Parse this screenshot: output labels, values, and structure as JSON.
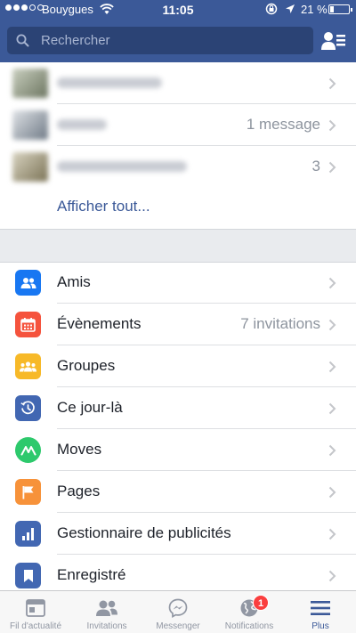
{
  "colors": {
    "brand": "#3b5998",
    "search_bg": "#2b4375",
    "separator": "#dddfe2",
    "muted_text": "#8d949e",
    "badge": "#fa3e3e"
  },
  "status_bar": {
    "carrier": "Bouygues",
    "time": "11:05",
    "battery_percent": "21 %",
    "battery_level": 0.21,
    "icons": [
      "signal-dots-icon",
      "wifi-icon",
      "rotation-lock-icon",
      "location-arrow-icon",
      "battery-icon"
    ]
  },
  "search": {
    "placeholder": "Rechercher",
    "value": "",
    "icon": "search-icon"
  },
  "header": {
    "right_icon": "friend-requests-icon"
  },
  "groups": {
    "items": [
      {
        "name_blurred": true,
        "right_text": "",
        "thumb_color": "#7d8a6e"
      },
      {
        "name_blurred": true,
        "right_text": "1 message",
        "thumb_color": "#6f7a86"
      },
      {
        "name_blurred": true,
        "right_text": "3",
        "thumb_color": "#a89a6b"
      }
    ],
    "see_all": "Afficher tout..."
  },
  "menu": {
    "items": [
      {
        "label": "Amis",
        "right_text": "",
        "icon": "friends-icon",
        "color": "#1877f2"
      },
      {
        "label": "Évènements",
        "right_text": "7 invitations",
        "icon": "calendar-icon",
        "color": "#f5533d"
      },
      {
        "label": "Groupes",
        "right_text": "",
        "icon": "groups-icon",
        "color": "#f7b928"
      },
      {
        "label": "Ce jour-là",
        "right_text": "",
        "icon": "on-this-day-icon",
        "color": "#4267b2"
      },
      {
        "label": "Moves",
        "right_text": "",
        "icon": "moves-icon",
        "color": "#2dc96c"
      },
      {
        "label": "Pages",
        "right_text": "",
        "icon": "flag-icon",
        "color": "#f7923a"
      },
      {
        "label": "Gestionnaire de publicités",
        "right_text": "",
        "icon": "ads-manager-icon",
        "color": "#4267b2"
      },
      {
        "label": "Enregistré",
        "right_text": "",
        "icon": "bookmark-icon",
        "color": "#4267b2"
      }
    ]
  },
  "tabs": [
    {
      "label": "Fil d'actualité",
      "icon": "news-feed-icon",
      "active": false
    },
    {
      "label": "Invitations",
      "icon": "invitations-icon",
      "active": false
    },
    {
      "label": "Messenger",
      "icon": "messenger-icon",
      "active": false
    },
    {
      "label": "Notifications",
      "icon": "globe-icon",
      "active": false,
      "badge": "1"
    },
    {
      "label": "Plus",
      "icon": "more-menu-icon",
      "active": true
    }
  ]
}
